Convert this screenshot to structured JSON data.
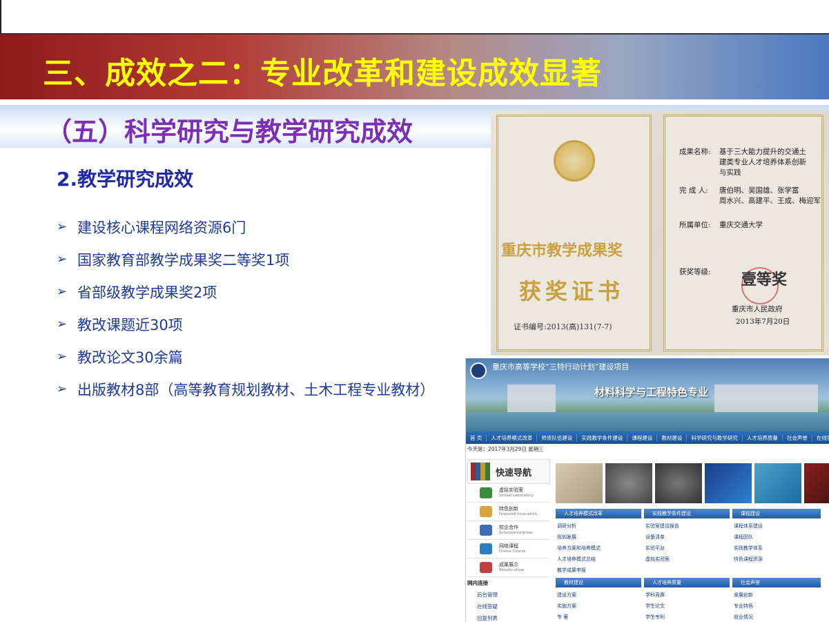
{
  "slide": {
    "title": "三、成效之二：专业改革和建设成效显著",
    "subtitle": "（五）科学研究与教学研究成效",
    "section_heading": "2.教学研究成效",
    "bullets": [
      "建设核心课程网络资源6门",
      "国家教育部教学成果奖二等奖1项",
      "省部级教学成果奖2项",
      "教改课题近30项",
      "教改论文30余篇",
      "出版教材8部（高等教育规划教材、土木工程专业教材）"
    ],
    "bullet_icon": "arrow-bullet-icon"
  },
  "certificate": {
    "award_name_line1": "重庆市教学成果奖",
    "award_name_line2": "获奖证书",
    "cert_number": "证书编号:2013(高)131(7-7)",
    "result_label": "成果名称:",
    "result_value": [
      "基于三大能力提升的交通土",
      "建类专业人才培养体系创新",
      "与实践"
    ],
    "completer_label": "完 成 人:",
    "completer_value": [
      "唐伯明、吴国雄、张学富",
      "周水兴、高建平、王成、梅迎军"
    ],
    "unit_label": "所属单位:",
    "unit_value": "重庆交通大学",
    "level_label": "获奖等级:",
    "level_value": "壹等奖",
    "issuer": "重庆市人民政府",
    "date": "2013年7月20日"
  },
  "website": {
    "project_title": "重庆市高等学校“三特行动计划”建设项目",
    "banner": "材料科学与工程特色专业",
    "nav": [
      "首 页",
      "人才培养模式改革",
      "师资队伍建设",
      "实践教学条件建设",
      "课程建设",
      "教材建设",
      "科学研究与教学研究",
      "人才培养质量",
      "社会声誉",
      "在线答疑"
    ],
    "date": "今天是：2017年3月29日 星期三",
    "quick_nav_title": "快速导航",
    "quick_items": [
      {
        "label": "虚拟实验室",
        "sub": "Virtual Laboratory",
        "color": "#3c8c3c"
      },
      {
        "label": "特色创新",
        "sub": "Featured Innovation",
        "color": "#d9a53a"
      },
      {
        "label": "校企合作",
        "sub": "School-enterprise",
        "color": "#3a6fb8"
      },
      {
        "label": "网络课程",
        "sub": "Online Course",
        "color": "#2f7fc0"
      },
      {
        "label": "成果展示",
        "sub": "Results show",
        "color": "#c23f3f"
      }
    ],
    "links_heading": "网内连接",
    "links": [
      "后台管理",
      "在线答疑",
      "回复列表"
    ],
    "columns": [
      {
        "head": "人才培养模式改革",
        "items": [
          "调研分析",
          "规划发展",
          "培养方案和培养模式",
          "人才培养模式总结",
          "教学成果申报"
        ]
      },
      {
        "head": "实践教学条件建设",
        "items": [
          "实验室建设报告",
          "设备清单",
          "实验平台",
          "虚拟实验室"
        ]
      },
      {
        "head": "课程建设",
        "items": [
          "课程体系建设",
          "课程团队",
          "实践教学体系",
          "特色课程资源"
        ]
      },
      {
        "head": "教材建设",
        "items": [
          "建设方案",
          "实施方案",
          "专 著"
        ]
      },
      {
        "head": "人才培养质量",
        "items": [
          "学科竞赛",
          "学生论文",
          "学生专利"
        ]
      },
      {
        "head": "社会声誉",
        "items": [
          "发展创新",
          "专业特色",
          "就业情况"
        ]
      }
    ]
  }
}
